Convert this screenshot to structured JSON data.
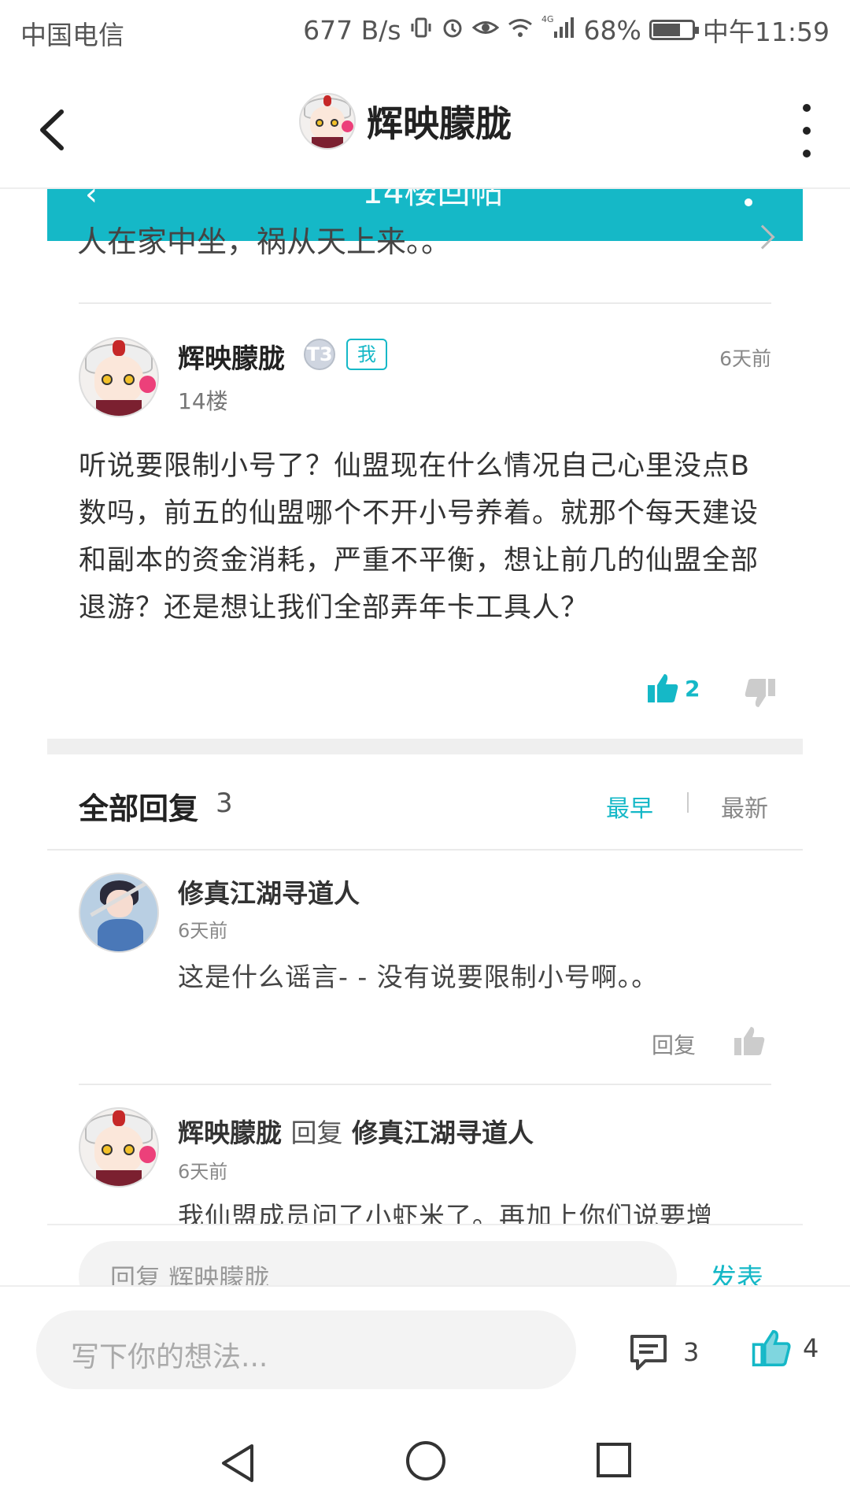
{
  "status_bar": {
    "carrier": "中国电信",
    "net_speed": "677 B/s",
    "signal_label": "4G",
    "battery": "68%",
    "battery_level": 0.68,
    "time": "中午11:59"
  },
  "header": {
    "title": "辉映朦胧"
  },
  "overlay": {
    "title_fragment": "14楼回帖",
    "text_fragment": "人在家中坐，祸从天上来。。"
  },
  "post": {
    "author": "辉映朦胧",
    "level_badge": "T3",
    "me_badge": "我",
    "floor": "14楼",
    "time": "6天前",
    "body": "听说要限制小号了？仙盟现在什么情况自己心里没点B数吗，前五的仙盟哪个不开小号养着。就那个每天建设和副本的资金消耗，严重不平衡，想让前几的仙盟全部退游？还是想让我们全部弄年卡工具人？",
    "like_count": "2"
  },
  "replies": {
    "title": "全部回复",
    "count": "3",
    "sort_earliest": "最早",
    "sort_latest": "最新",
    "items": [
      {
        "author": "修真江湖寻道人",
        "time": "6天前",
        "text": "这是什么谣言- - 没有说要限制小号啊。。",
        "reply_label": "回复"
      },
      {
        "author": "辉映朦胧",
        "reply_to_word": "回复",
        "reply_to": "修真江湖寻道人",
        "time": "6天前",
        "text": "我仙盟成员问了小虾米了。再加上你们说要增"
      }
    ]
  },
  "reply_input": {
    "placeholder": "回复 辉映朦胧",
    "send_label": "发表"
  },
  "bottom_bar": {
    "placeholder": "写下你的想法...",
    "comment_count": "3",
    "like_count": "4"
  },
  "colors": {
    "accent": "#15b8c7",
    "text": "#222222",
    "muted": "#888888"
  }
}
